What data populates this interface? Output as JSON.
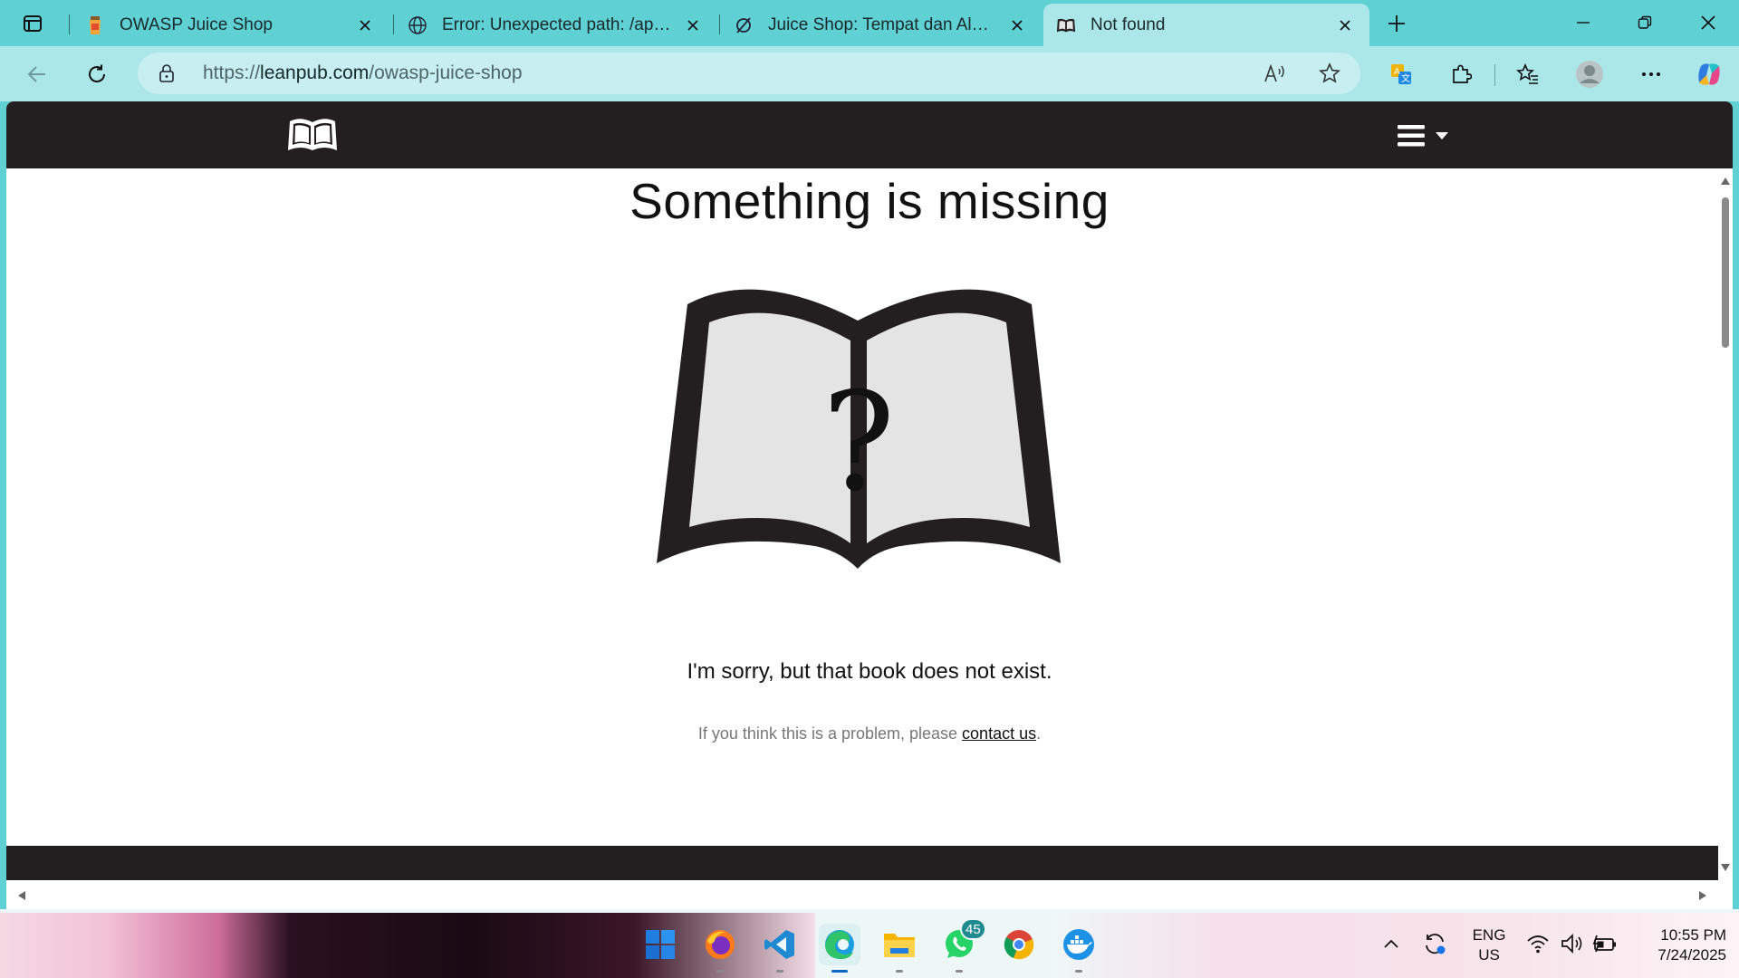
{
  "browser": {
    "tabs": [
      {
        "title": "OWASP Juice Shop",
        "icon": "juice-shop-favicon"
      },
      {
        "title": "Error: Unexpected path: /api/profi",
        "icon": "globe-icon"
      },
      {
        "title": "Juice Shop: Tempat dan Alat Sega",
        "icon": "leanpub-favicon"
      },
      {
        "title": "Not found",
        "icon": "leanpub-book-favicon",
        "active": true
      }
    ],
    "address": {
      "scheme": "https://",
      "domain": "leanpub.com",
      "path": "/owasp-juice-shop"
    }
  },
  "page": {
    "headline": "Something is missing",
    "illustration_symbol": "?",
    "sorry_text": "I'm sorry, but that book does not exist.",
    "problem_prefix": "If you think this is a problem, please ",
    "contact_link": "contact us",
    "problem_suffix": "."
  },
  "taskbar": {
    "apps": [
      "windows-start",
      "firefox",
      "vscode",
      "edge",
      "file-explorer",
      "whatsapp",
      "chrome",
      "docker-desktop"
    ],
    "whatsapp_badge": "45",
    "language": {
      "line1": "ENG",
      "line2": "US"
    },
    "clock": {
      "time": "10:55 PM",
      "date": "7/24/2025"
    }
  },
  "colors": {
    "frame": "#5fd0d4",
    "toolbar": "#abe6e8",
    "site_dark": "#231f20",
    "book_page": "#e4e4e4"
  }
}
